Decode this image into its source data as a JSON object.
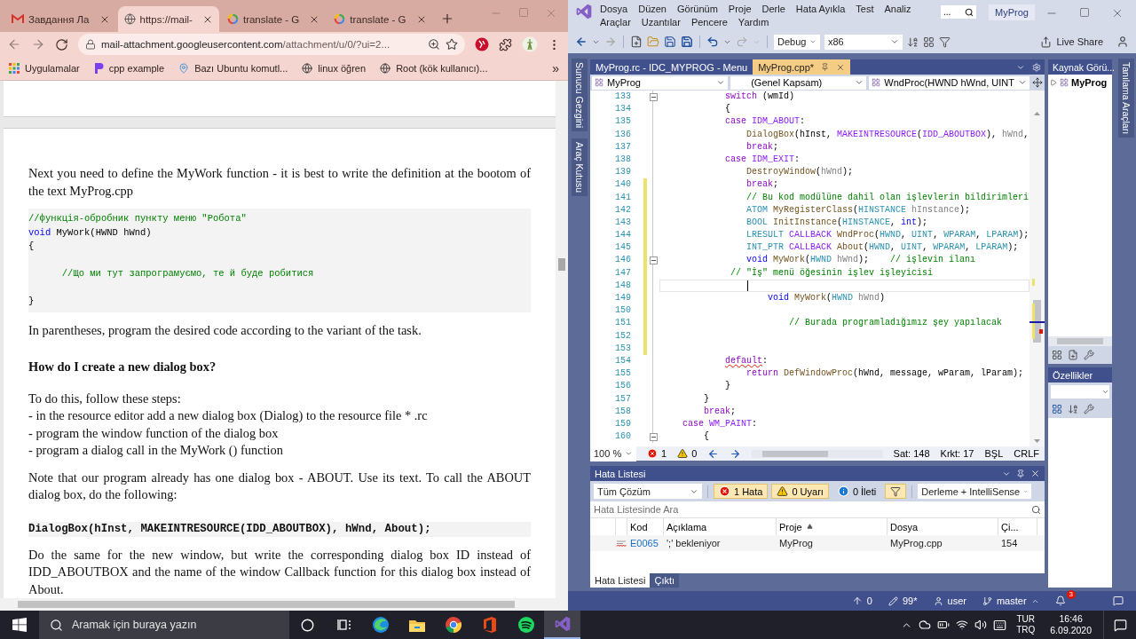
{
  "browser": {
    "tabs": [
      {
        "kind": "gmail",
        "title": "Завдання Ла",
        "selected": false
      },
      {
        "kind": "globe",
        "title": "https://mail-",
        "selected": true
      },
      {
        "kind": "google",
        "title": "translate - G",
        "selected": false
      },
      {
        "kind": "google",
        "title": "translate - G",
        "selected": false
      }
    ],
    "address": {
      "host": "mail-attachment.googleusercontent.com",
      "path": "/attachment/u/0/?ui=2..."
    },
    "bookmarks": [
      {
        "kind": "apps",
        "label": "Uygulamalar"
      },
      {
        "kind": "cpp",
        "label": "cpp example"
      },
      {
        "kind": "pin",
        "label": "Bazı Ubuntu komutl..."
      },
      {
        "kind": "globe",
        "label": "linux öğren"
      },
      {
        "kind": "globe",
        "label": "Root (kök kullanıcı)..."
      }
    ],
    "bookmarks_more": "»",
    "document": [
      {
        "kind": "paragraph",
        "text": "Next you need to define the MyWork function - it is best to write the definition at the bootom of the text MyProg.cpp"
      },
      {
        "kind": "code",
        "lines": [
          {
            "kind": "code",
            "tokens": [
              {
                "kind": "comment",
                "text": "//функція-обробник пункту меню \"Робота\""
              }
            ]
          },
          {
            "kind": "code",
            "tokens": [
              {
                "kind": "keyword",
                "text": "void"
              },
              {
                "kind": "plain",
                "text": " MyWork(HWND hWnd)"
              }
            ]
          },
          {
            "kind": "code",
            "tokens": [
              {
                "kind": "plain",
                "text": "{"
              }
            ]
          },
          {
            "kind": "blank"
          },
          {
            "kind": "code",
            "tokens": [
              {
                "kind": "comment",
                "text": "      //Що ми тут запрограмуємо, те й буде робитися"
              }
            ]
          },
          {
            "kind": "blank"
          },
          {
            "kind": "code",
            "tokens": [
              {
                "kind": "plain",
                "text": "}"
              }
            ]
          }
        ]
      },
      {
        "kind": "paragraph",
        "text": "In parentheses, program the desired code according to the variant of the task."
      },
      {
        "kind": "heading",
        "text": "How do I create a new dialog box?"
      },
      {
        "kind": "lines",
        "lines": [
          "To do this, follow these steps:",
          "- in the resource editor add a new dialog box (Dialog) to the resource file * .rc",
          "- program the window function of the dialog box",
          "- program a dialog call in the MyWork () function"
        ]
      },
      {
        "kind": "paragraph",
        "text": "Note that our program already has one dialog box - ABOUT. Use its text. To call the ABOUT dialog box, do the following:"
      },
      {
        "kind": "mono",
        "text": "DialogBox(hInst, MAKEINTRESOURCE(IDD_ABOUTBOX), hWnd, About);"
      },
      {
        "kind": "paragraph",
        "text": "Do the same for the new window, but write the corresponding dialog box ID instead of IDD_ABOUTBOX and the name of the window Callback function for this dialog box instead of About."
      }
    ]
  },
  "ide": {
    "menu": [
      "Dosya",
      "Düzen",
      "Görünüm",
      "Proje",
      "Derle",
      "Hata Ayıkla",
      "Test",
      "Analiz",
      "Araçlar",
      "Uzantılar",
      "Pencere",
      "Yardım"
    ],
    "search": "...",
    "title": "MyProg",
    "toolbar": {
      "configuration": "Debug",
      "platform": "x86",
      "live_share": "Live Share"
    },
    "left_tabs": [
      "Sunucu Gezgini",
      "Araç Kutusu"
    ],
    "right_tabs": [
      "Tanılama Araçları"
    ],
    "editor": {
      "tabs": [
        {
          "title": "MyProg.rc - IDC_MYPROG - Menu",
          "selected": false
        },
        {
          "title": "MyProg.cpp*",
          "selected": true
        }
      ],
      "nav": [
        "MyProg",
        "(Genel Kapsam)",
        "WndProc(HWND hWnd, UINT"
      ],
      "lines": [
        {
          "number": "133",
          "modified": false,
          "fold": true,
          "current": false,
          "tokens": [
            {
              "kind": "control",
              "text": "            switch"
            },
            {
              "kind": "plain",
              "text": " (wmId)"
            }
          ]
        },
        {
          "number": "134",
          "modified": false,
          "fold": false,
          "current": false,
          "tokens": [
            {
              "kind": "plain",
              "text": "            {"
            }
          ]
        },
        {
          "number": "135",
          "modified": false,
          "fold": false,
          "current": false,
          "tokens": [
            {
              "kind": "control",
              "text": "            case"
            },
            {
              "kind": "macro",
              "text": " IDM_ABOUT"
            },
            {
              "kind": "plain",
              "text": ":"
            }
          ]
        },
        {
          "number": "136",
          "modified": false,
          "fold": false,
          "current": false,
          "tokens": [
            {
              "kind": "function",
              "text": "                DialogBox"
            },
            {
              "kind": "plain",
              "text": "(hInst, "
            },
            {
              "kind": "macro",
              "text": "MAKEINTRESOURCE"
            },
            {
              "kind": "plain",
              "text": "("
            },
            {
              "kind": "macro",
              "text": "IDD_ABOUTBOX"
            },
            {
              "kind": "plain",
              "text": "), "
            },
            {
              "kind": "param",
              "text": "hWnd"
            },
            {
              "kind": "plain",
              "text": ","
            }
          ]
        },
        {
          "number": "137",
          "modified": false,
          "fold": false,
          "current": false,
          "tokens": [
            {
              "kind": "control",
              "text": "                break"
            },
            {
              "kind": "plain",
              "text": ";"
            }
          ]
        },
        {
          "number": "138",
          "modified": false,
          "fold": false,
          "current": false,
          "tokens": [
            {
              "kind": "control",
              "text": "            case"
            },
            {
              "kind": "macro",
              "text": " IDM_EXIT"
            },
            {
              "kind": "plain",
              "text": ":"
            }
          ]
        },
        {
          "number": "139",
          "modified": false,
          "fold": false,
          "current": false,
          "tokens": [
            {
              "kind": "function",
              "text": "                DestroyWindow"
            },
            {
              "kind": "plain",
              "text": "("
            },
            {
              "kind": "param",
              "text": "hWnd"
            },
            {
              "kind": "plain",
              "text": ");"
            }
          ]
        },
        {
          "number": "140",
          "modified": true,
          "fold": false,
          "current": false,
          "tokens": [
            {
              "kind": "control",
              "text": "                break"
            },
            {
              "kind": "plain",
              "text": ";"
            }
          ]
        },
        {
          "number": "141",
          "modified": true,
          "fold": false,
          "current": false,
          "tokens": [
            {
              "kind": "comment",
              "text": "                // Bu kod modülüne dahil olan işlevlerin bildirimleri"
            }
          ]
        },
        {
          "number": "142",
          "modified": true,
          "fold": false,
          "current": false,
          "tokens": [
            {
              "kind": "type",
              "text": "                ATOM"
            },
            {
              "kind": "function",
              "text": " MyRegisterClass"
            },
            {
              "kind": "plain",
              "text": "("
            },
            {
              "kind": "type",
              "text": "HINSTANCE"
            },
            {
              "kind": "param",
              "text": " hInstance"
            },
            {
              "kind": "plain",
              "text": ");"
            }
          ]
        },
        {
          "number": "143",
          "modified": true,
          "fold": false,
          "current": false,
          "tokens": [
            {
              "kind": "type",
              "text": "                BOOL"
            },
            {
              "kind": "function",
              "text": " InitInstance"
            },
            {
              "kind": "plain",
              "text": "("
            },
            {
              "kind": "type",
              "text": "HINSTANCE"
            },
            {
              "kind": "plain",
              "text": ", "
            },
            {
              "kind": "keyword",
              "text": "int"
            },
            {
              "kind": "plain",
              "text": ");"
            }
          ]
        },
        {
          "number": "144",
          "modified": true,
          "fold": false,
          "current": false,
          "tokens": [
            {
              "kind": "type",
              "text": "                LRESULT"
            },
            {
              "kind": "macro",
              "text": " CALLBACK"
            },
            {
              "kind": "function",
              "text": " WndProc"
            },
            {
              "kind": "plain",
              "text": "("
            },
            {
              "kind": "type",
              "text": "HWND"
            },
            {
              "kind": "plain",
              "text": ", "
            },
            {
              "kind": "type",
              "text": "UINT"
            },
            {
              "kind": "plain",
              "text": ", "
            },
            {
              "kind": "type",
              "text": "WPARAM"
            },
            {
              "kind": "plain",
              "text": ", "
            },
            {
              "kind": "type",
              "text": "LPARAM"
            },
            {
              "kind": "plain",
              "text": ");"
            }
          ]
        },
        {
          "number": "145",
          "modified": true,
          "fold": false,
          "current": false,
          "tokens": [
            {
              "kind": "type",
              "text": "                INT_PTR"
            },
            {
              "kind": "macro",
              "text": " CALLBACK"
            },
            {
              "kind": "function",
              "text": " About"
            },
            {
              "kind": "plain",
              "text": "("
            },
            {
              "kind": "type",
              "text": "HWND"
            },
            {
              "kind": "plain",
              "text": ", "
            },
            {
              "kind": "type",
              "text": "UINT"
            },
            {
              "kind": "plain",
              "text": ", "
            },
            {
              "kind": "type",
              "text": "WPARAM"
            },
            {
              "kind": "plain",
              "text": ", "
            },
            {
              "kind": "type",
              "text": "LPARAM"
            },
            {
              "kind": "plain",
              "text": ");"
            }
          ]
        },
        {
          "number": "146",
          "modified": true,
          "fold": true,
          "current": false,
          "tokens": [
            {
              "kind": "keyword",
              "text": "                void"
            },
            {
              "kind": "function",
              "text": " MyWork"
            },
            {
              "kind": "plain",
              "text": "("
            },
            {
              "kind": "type",
              "text": "HWND"
            },
            {
              "kind": "param",
              "text": " hWnd"
            },
            {
              "kind": "plain",
              "text": ");    "
            },
            {
              "kind": "comment",
              "text": "// işlevin ilanı"
            }
          ]
        },
        {
          "number": "147",
          "modified": true,
          "fold": false,
          "current": false,
          "tokens": [
            {
              "kind": "comment",
              "text": "             // \"İş\" menü öğesinin işlev işleyicisi"
            }
          ]
        },
        {
          "number": "148",
          "modified": true,
          "fold": false,
          "current": true
        },
        {
          "number": "149",
          "modified": true,
          "fold": false,
          "current": false,
          "tokens": [
            {
              "kind": "keyword",
              "text": "                    void"
            },
            {
              "kind": "function",
              "text": " MyWork"
            },
            {
              "kind": "plain",
              "text": "("
            },
            {
              "kind": "type",
              "text": "HWND"
            },
            {
              "kind": "param",
              "text": " hWnd"
            },
            {
              "kind": "plain",
              "text": ")"
            }
          ]
        },
        {
          "number": "150",
          "modified": true,
          "fold": false,
          "current": false
        },
        {
          "number": "151",
          "modified": true,
          "fold": false,
          "current": false,
          "tokens": [
            {
              "kind": "comment",
              "text": "                        // Burada programladığımız şey yapılacak"
            }
          ]
        },
        {
          "number": "152",
          "modified": true,
          "fold": false,
          "current": false
        },
        {
          "number": "153",
          "modified": true,
          "fold": false,
          "current": false
        },
        {
          "number": "154",
          "modified": false,
          "fold": false,
          "current": false,
          "tokens": [
            {
              "kind": "control",
              "text": "            default",
              "error": true
            },
            {
              "kind": "plain",
              "text": ":"
            }
          ]
        },
        {
          "number": "155",
          "modified": false,
          "fold": false,
          "current": false,
          "tokens": [
            {
              "kind": "control",
              "text": "                return"
            },
            {
              "kind": "function",
              "text": " DefWindowProc"
            },
            {
              "kind": "plain",
              "text": "(hWnd, message, wParam, lParam);"
            }
          ]
        },
        {
          "number": "156",
          "modified": false,
          "fold": false,
          "current": false,
          "tokens": [
            {
              "kind": "plain",
              "text": "            }"
            }
          ]
        },
        {
          "number": "157",
          "modified": false,
          "fold": false,
          "current": false,
          "tokens": [
            {
              "kind": "plain",
              "text": "        }"
            }
          ]
        },
        {
          "number": "158",
          "modified": false,
          "fold": false,
          "current": false,
          "tokens": [
            {
              "kind": "control",
              "text": "        break"
            },
            {
              "kind": "plain",
              "text": ";"
            }
          ]
        },
        {
          "number": "159",
          "modified": false,
          "fold": false,
          "current": false,
          "tokens": [
            {
              "kind": "control",
              "text": "    case"
            },
            {
              "kind": "macro",
              "text": " WM_PAINT"
            },
            {
              "kind": "plain",
              "text": ":"
            }
          ]
        },
        {
          "number": "160",
          "modified": false,
          "fold": true,
          "current": false,
          "tokens": [
            {
              "kind": "plain",
              "text": "        {"
            }
          ]
        }
      ],
      "status": {
        "zoom": "100 %",
        "errors": "1",
        "warnings": "0",
        "line": "Sat: 148",
        "column": "Krkt: 17",
        "insert_mode": "BŞL",
        "line_ending": "CRLF"
      }
    },
    "error_list": {
      "title": "Hata Listesi",
      "scope": "Tüm Çözüm",
      "filters": [
        {
          "kind": "error",
          "label": "1 Hata",
          "on": true
        },
        {
          "kind": "warning",
          "label": "0 Uyarı",
          "on": true
        },
        {
          "kind": "info",
          "label": "0 İleti",
          "on": false
        }
      ],
      "filter_active": true,
      "source": "Derleme + IntelliSense",
      "search_placeholder": "Hata Listesinde Ara",
      "columns": [
        {
          "label": "Kod",
          "sorted": false
        },
        {
          "label": "Açıklama",
          "sorted": false
        },
        {
          "label": "Proje",
          "sorted": true
        },
        {
          "label": "Dosya",
          "sorted": false
        },
        {
          "label": "Çi...",
          "sorted": false
        }
      ],
      "rows": [
        {
          "code": "E0065",
          "description": "';' bekleniyor",
          "project": "MyProg",
          "file": "MyProg.cpp",
          "line": "154"
        }
      ],
      "tabs": [
        {
          "title": "Hata Listesi",
          "selected": true
        },
        {
          "title": "Çıktı",
          "selected": false
        }
      ]
    },
    "solution_explorer": {
      "title": "Kaynak Görü...",
      "root": "MyProg"
    },
    "properties": {
      "title": "Özellikler"
    },
    "status": {
      "sync": "0",
      "changes": "99*",
      "user": "user",
      "branch": "master",
      "notifications": "3"
    }
  },
  "taskbar": {
    "search_placeholder": "Aramak için buraya yazın",
    "apps": [
      {
        "kind": "cortana",
        "active": false
      },
      {
        "kind": "taskview",
        "active": false
      },
      {
        "kind": "edge",
        "active": false
      },
      {
        "kind": "explorer",
        "active": false
      },
      {
        "kind": "chrome",
        "active": false
      },
      {
        "kind": "office",
        "active": false
      },
      {
        "kind": "spotify",
        "active": false
      },
      {
        "kind": "vs",
        "active": true
      }
    ],
    "input_language": "TUR",
    "keyboard": "TRQ",
    "time": "16:46",
    "date": "6.09.2020"
  }
}
